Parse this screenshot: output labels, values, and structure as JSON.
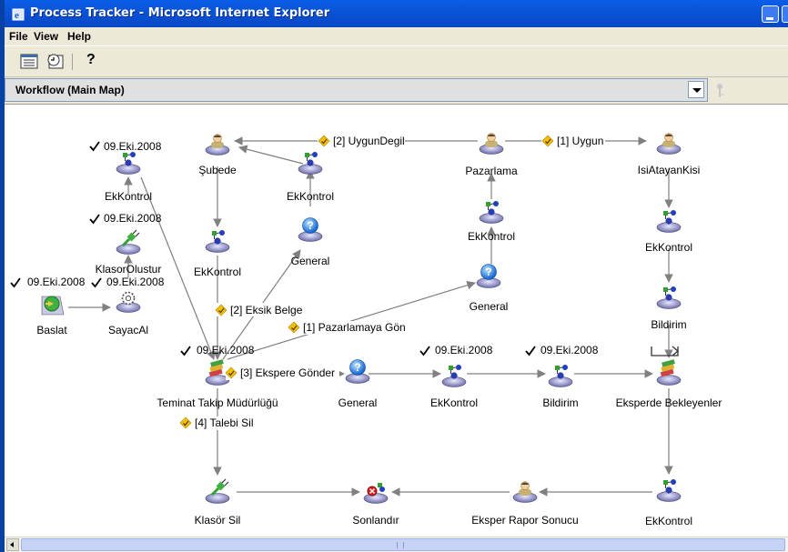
{
  "window": {
    "title": "Process Tracker - Microsoft Internet Explorer"
  },
  "menu": {
    "file": "File",
    "view": "View",
    "help": "Help"
  },
  "toolbar": {
    "help_label": "?"
  },
  "workflow": {
    "selector_value": "Workflow (Main Map)"
  },
  "nodes": {
    "ekkontrol_left": "EkKontrol",
    "klasor_olustur": "KlasorOlustur",
    "baslat": "Baslat",
    "sayacal": "SayacAl",
    "subede": "Şubede",
    "ekkontrol_subede": "EkKontrol",
    "ekkontrol_mid": "EkKontrol",
    "general_mid": "General",
    "pazarlama": "Pazarlama",
    "ekkontrol_pazarlama": "EkKontrol",
    "general_right": "General",
    "isiatayan": "IsiAtayanKisi",
    "ekkontrol_right": "EkKontrol",
    "bildirim_right": "Bildirim",
    "teminat": "Teminat Takip Müdürlüğü",
    "general_bottom": "General",
    "ekkontrol_bottom": "EkKontrol",
    "bildirim_bottom": "Bildirim",
    "eksperde": "Eksperde Bekleyenler",
    "klasor_sil": "Klasör Sil",
    "sonlandir": "Sonlandır",
    "eksper_rapor": "Eksper Rapor Sonucu",
    "ekkontrol_final": "EkKontrol"
  },
  "dates": {
    "d1": "09.Eki.2008",
    "d2": "09.Eki.2008",
    "d3": "09.Eki.2008",
    "d4": "09.Eki.2008",
    "d5": "09.Eki.2008",
    "d6": "09.Eki.2008",
    "d7": "09.Eki.2008"
  },
  "transitions": {
    "uygun_degil": "[2] UygunDegil",
    "uygun": "[1] Uygun",
    "eksik_belge": "[2] Eksik Belge",
    "pazarlamaya_gon": "[1] Pazarlamaya Gön",
    "ekspere_gonder": "[3] Ekspere Gönder",
    "talebi_sil": "[4] Talebi Sil"
  },
  "colors": {
    "titlebar": "#0a54d8",
    "node_base": "#8888cc",
    "edge": "#808080",
    "transition_diamond": "#f5c000",
    "help_circle": "#1e7fe0",
    "end_red": "#e02020"
  }
}
